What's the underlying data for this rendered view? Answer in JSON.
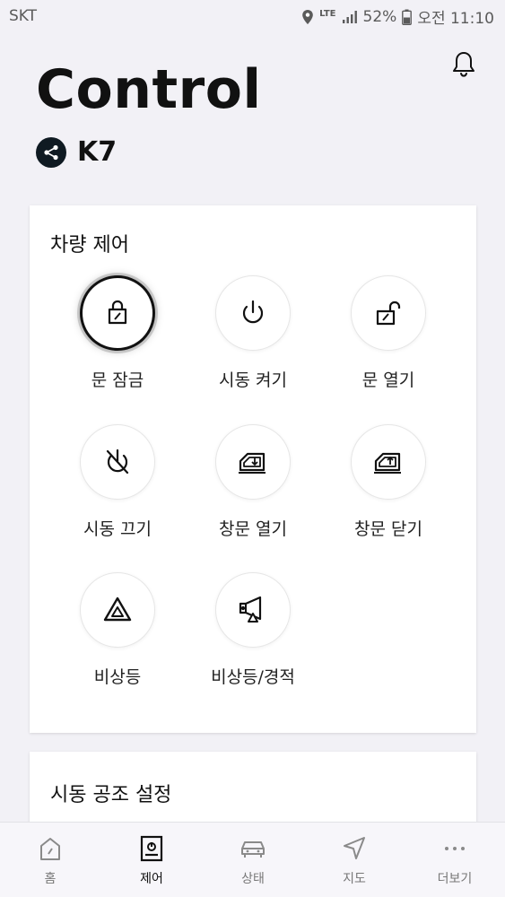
{
  "status_bar": {
    "carrier": "SKT",
    "network": "LTE",
    "battery": "52%",
    "time": "오전 11:10"
  },
  "header": {
    "title": "Control",
    "vehicle": "K7"
  },
  "control_card": {
    "title": "차량 제어",
    "items": [
      {
        "label": "문 잠금",
        "icon": "lock-icon",
        "selected": true
      },
      {
        "label": "시동 켜기",
        "icon": "power-on-icon",
        "selected": false
      },
      {
        "label": "문 열기",
        "icon": "unlock-icon",
        "selected": false
      },
      {
        "label": "시동 끄기",
        "icon": "power-off-icon",
        "selected": false
      },
      {
        "label": "창문 열기",
        "icon": "window-open-icon",
        "selected": false
      },
      {
        "label": "창문 닫기",
        "icon": "window-close-icon",
        "selected": false
      },
      {
        "label": "비상등",
        "icon": "hazard-icon",
        "selected": false
      },
      {
        "label": "비상등/경적",
        "icon": "hazard-horn-icon",
        "selected": false
      }
    ]
  },
  "climate_card": {
    "title": "시동 공조 설정"
  },
  "bottom_nav": {
    "active": "제어",
    "items": [
      {
        "label": "홈",
        "icon": "home-icon"
      },
      {
        "label": "제어",
        "icon": "control-icon"
      },
      {
        "label": "상태",
        "icon": "car-icon"
      },
      {
        "label": "지도",
        "icon": "navigation-icon"
      },
      {
        "label": "더보기",
        "icon": "more-icon"
      }
    ]
  }
}
